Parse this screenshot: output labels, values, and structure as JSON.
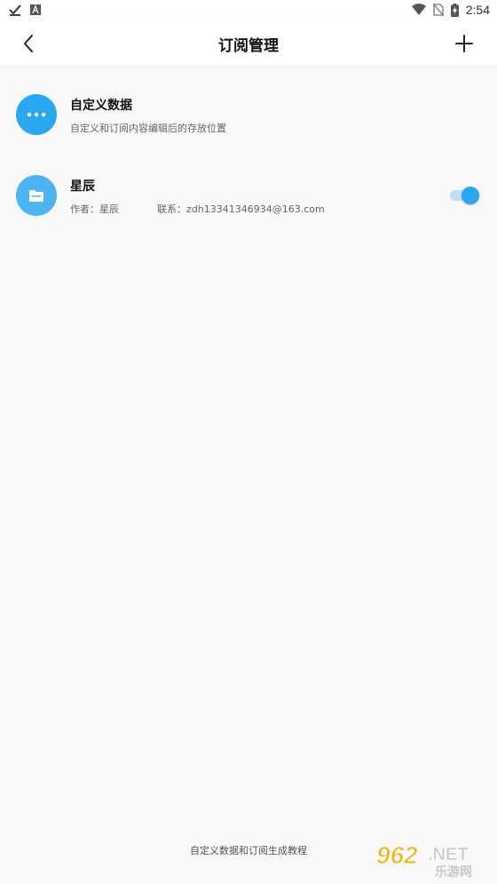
{
  "status_bar": {
    "time": "2:54",
    "icons": [
      "check-icon",
      "a-notification-icon",
      "wifi-icon",
      "no-sim-icon",
      "battery-charging-icon"
    ]
  },
  "app_bar": {
    "title": "订阅管理",
    "back_icon": "chevron-left-icon",
    "add_icon": "plus-icon"
  },
  "items": [
    {
      "icon": "more-dots-icon",
      "title": "自定义数据",
      "subtitle": "自定义和订阅内容编辑后的存放位置"
    },
    {
      "icon": "folder-icon",
      "title": "星辰",
      "author": "作者：星辰",
      "contact": "联系：zdh13341346934@163.com",
      "enabled": true
    }
  ],
  "footer": {
    "link": "自定义数据和订阅生成教程"
  },
  "watermark": {
    "text_top": "962.NET",
    "text_bottom": "乐游网"
  },
  "colors": {
    "accent": "#29a7f0",
    "background": "#f8f8f8"
  }
}
